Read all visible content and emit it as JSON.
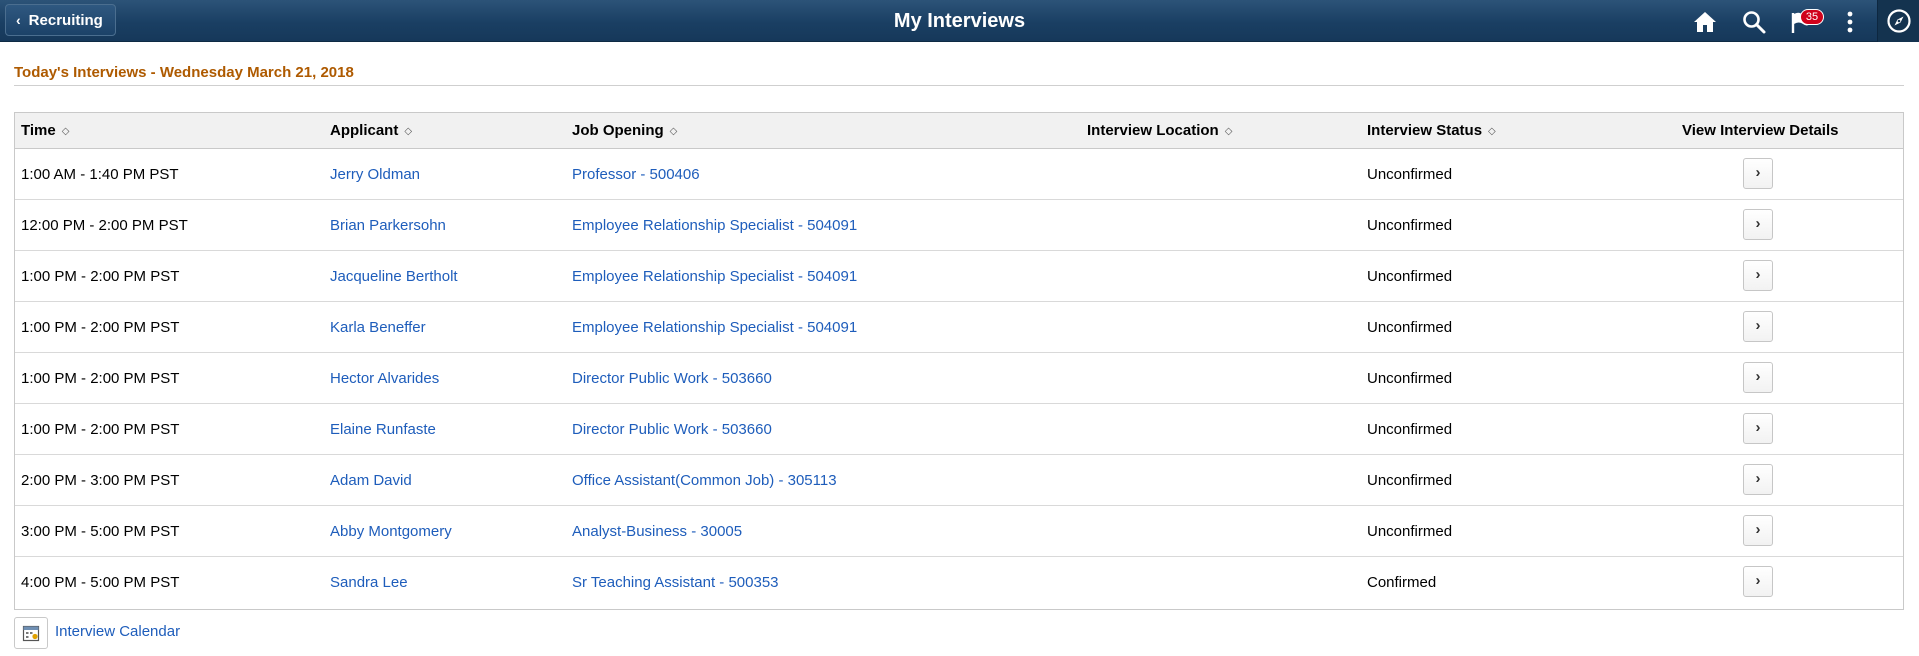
{
  "header": {
    "back_label": "Recruiting",
    "title": "My Interviews",
    "notification_count": "35",
    "icons": [
      "home-icon",
      "search-icon",
      "flag-icon",
      "more-vertical-icon",
      "compass-icon"
    ]
  },
  "section": {
    "heading": "Today's Interviews - Wednesday March 21, 2018"
  },
  "table": {
    "columns": {
      "time": "Time",
      "applicant": "Applicant",
      "job_opening": "Job Opening",
      "location": "Interview Location",
      "status": "Interview Status",
      "details": "View Interview Details"
    },
    "rows": [
      {
        "time": "1:00 AM - 1:40 PM PST",
        "applicant": "Jerry Oldman",
        "job_opening": "Professor - 500406",
        "location": "",
        "status": "Unconfirmed"
      },
      {
        "time": "12:00 PM - 2:00 PM PST",
        "applicant": "Brian Parkersohn",
        "job_opening": "Employee Relationship Specialist - 504091",
        "location": "",
        "status": "Unconfirmed"
      },
      {
        "time": "1:00 PM - 2:00 PM PST",
        "applicant": "Jacqueline Bertholt",
        "job_opening": "Employee Relationship Specialist - 504091",
        "location": "",
        "status": "Unconfirmed"
      },
      {
        "time": "1:00 PM - 2:00 PM PST",
        "applicant": "Karla Beneffer",
        "job_opening": "Employee Relationship Specialist - 504091",
        "location": "",
        "status": "Unconfirmed"
      },
      {
        "time": "1:00 PM - 2:00 PM PST",
        "applicant": "Hector Alvarides",
        "job_opening": "Director Public Work - 503660",
        "location": "",
        "status": "Unconfirmed"
      },
      {
        "time": "1:00 PM - 2:00 PM PST",
        "applicant": "Elaine Runfaste",
        "job_opening": "Director Public Work - 503660",
        "location": "",
        "status": "Unconfirmed"
      },
      {
        "time": "2:00 PM - 3:00 PM PST",
        "applicant": "Adam David",
        "job_opening": "Office Assistant(Common Job) - 305113",
        "location": "",
        "status": "Unconfirmed"
      },
      {
        "time": "3:00 PM - 5:00 PM PST",
        "applicant": "Abby Montgomery",
        "job_opening": "Analyst-Business - 30005",
        "location": "",
        "status": "Unconfirmed"
      },
      {
        "time": "4:00 PM - 5:00 PM PST",
        "applicant": "Sandra Lee",
        "job_opening": "Sr Teaching Assistant - 500353",
        "location": "",
        "status": "Confirmed"
      }
    ]
  },
  "footer": {
    "calendar_link": "Interview Calendar"
  },
  "colors": {
    "banner": "#1a3f63",
    "heading": "#ae5a00",
    "link": "#1e5dbb",
    "badge": "#d0021b"
  }
}
